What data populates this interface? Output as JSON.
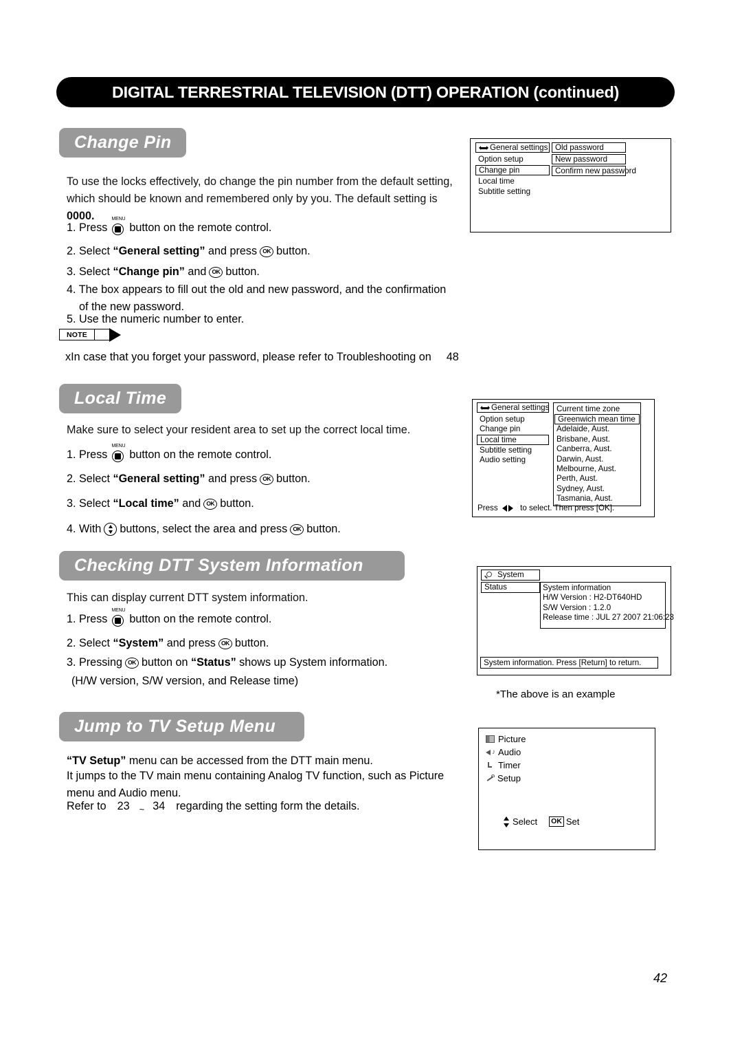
{
  "page": {
    "banner_title": "DIGITAL TERRESTRIAL TELEVISION (DTT) OPERATION (continued)",
    "number": "42"
  },
  "sections": {
    "change_pin": {
      "heading": "Change Pin",
      "intro_line1": "To use the locks effectively, do change the pin number from the default setting,",
      "intro_line2": "which should be known and remembered only by you. The default setting is",
      "intro_bold": "0000.",
      "steps": {
        "s1_num": "1. Press",
        "s1_icon_caption": "MENU",
        "s1_tail": "button on the remote control.",
        "s2_num": "2. Select",
        "s2_target": "“General setting”",
        "s2_mid": "and press",
        "s2_tail": "button.",
        "s3_num": "3. Select",
        "s3_target": "“Change pin”",
        "s3_mid": "and",
        "s3_tail": "button.",
        "s4_line1": "4. The box appears to fill out the old and new password, and the confirmation",
        "s4_line2": "of the new password.",
        "s5": "5. Use the numeric number to enter."
      },
      "note_label": "NOTE",
      "note_text": "xIn case that you forget your password, please refer to Troubleshooting on",
      "note_page": "48"
    },
    "local_time": {
      "heading": "Local Time",
      "intro": "Make sure to select your resident area to set up the correct local time.",
      "steps": {
        "s1_num": "1. Press",
        "s1_icon_caption": "MENU",
        "s1_tail": "button on the remote control.",
        "s2_num": "2. Select",
        "s2_target": "“General setting”",
        "s2_mid": "and press",
        "s2_tail": "button.",
        "s3_num": "3. Select",
        "s3_target": "“Local time”",
        "s3_mid": "and",
        "s3_tail": "button.",
        "s4_num": "4. With",
        "s4_mid": "buttons, select the area and press",
        "s4_tail": "button."
      }
    },
    "system_info": {
      "heading": "Checking DTT System Information",
      "intro": "This can display current DTT system information.",
      "steps": {
        "s1_num": "1. Press",
        "s1_icon_caption": "MENU",
        "s1_tail": "button on the remote control.",
        "s2_num": "2. Select",
        "s2_target": "“System”",
        "s2_mid": "and press",
        "s2_tail": "button.",
        "s3_num": "3. Pressing",
        "s3_mid": "button on",
        "s3_target": "“Status”",
        "s3_tail": "shows up System information.",
        "s3_sub": "(H/W version, S/W version, and Release time)"
      },
      "example_caption": "*The above is an example"
    },
    "tv_setup": {
      "heading": "Jump to TV Setup Menu",
      "line1_bold": "“TV Setup”",
      "line1_rest": "menu can be accessed from the DTT main menu.",
      "line2": "It jumps to the TV main menu containing Analog TV function, such as Picture",
      "line3": "menu and Audio menu.",
      "line4_pre": "Refer to",
      "line4_page_from": "23",
      "line4_tilde": "~",
      "line4_page_to": "34",
      "line4_post": "regarding the setting form the details."
    }
  },
  "osd": {
    "change_pin": {
      "left_title": "General settings",
      "left_items": [
        "Option setup",
        "Change pin",
        "Local time",
        "Subtitle setting"
      ],
      "left_selected": "Change pin",
      "right_items": [
        "Old password",
        "New password",
        "Confirm new password"
      ]
    },
    "local_time": {
      "left_title": "General settings",
      "left_items": [
        "Option setup",
        "Change pin",
        "Local time",
        "Subtitle setting",
        "Audio setting"
      ],
      "left_selected": "Local time",
      "right_title": "Current time zone",
      "right_items": [
        "Greenwich mean time",
        "Adelaide, Aust.",
        "Brisbane, Aust.",
        "Canberra, Aust.",
        "Darwin, Aust.",
        "Melbourne, Aust.",
        "Perth, Aust.",
        "Sydney, Aust.",
        "Tasmania, Aust."
      ],
      "right_selected": "Greenwich mean time",
      "hint_pre": "Press",
      "hint_post": "to select. Then press [OK]."
    },
    "system": {
      "title": "System",
      "status_label": "Status",
      "info_title": "System information",
      "info_lines": [
        "H/W Version : H2-DT640HD",
        "S/W Version : 1.2.0",
        "Release time : JUL 27 2007 21:06:23"
      ],
      "footer": "System information. Press [Return] to return."
    },
    "tv_menu": {
      "items": [
        {
          "label": "Picture",
          "icon": "picture-icon"
        },
        {
          "label": "Audio",
          "icon": "audio-icon"
        },
        {
          "label": "Timer",
          "icon": "timer-icon"
        },
        {
          "label": "Setup",
          "icon": "wrench-icon"
        }
      ],
      "select_label": "Select",
      "ok_label": "OK",
      "set_label": "Set"
    }
  },
  "colors": {
    "banner_bg": "#000000",
    "section_heading_bg": "#999999",
    "page_bg": "#ffffff"
  }
}
